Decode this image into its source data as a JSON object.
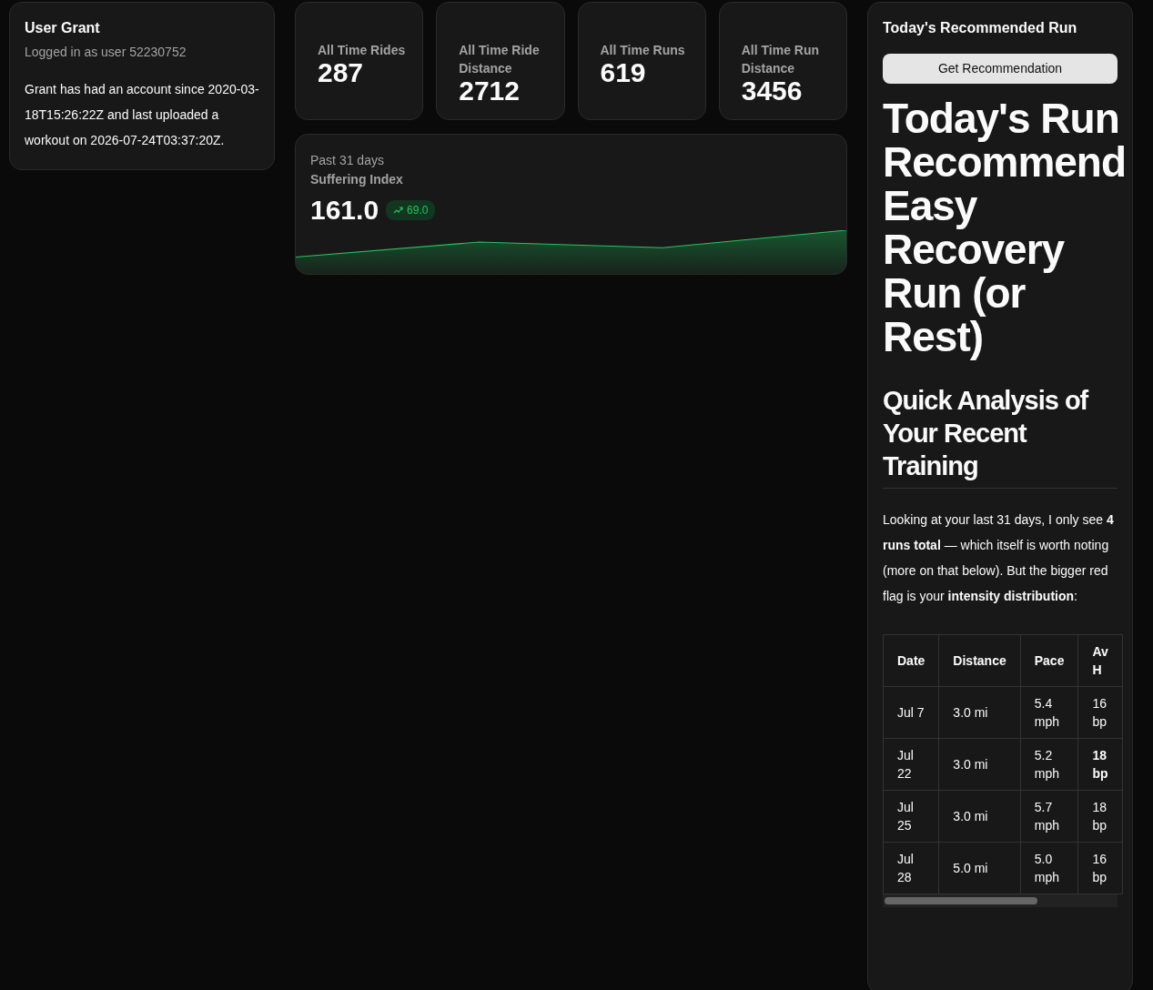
{
  "user_card": {
    "title": "User Grant",
    "subtitle": "Logged in as user 52230752",
    "description": "Grant has had an account since 2020-03-18T15:26:22Z and last uploaded a workout on 2026-07-24T03:37:20Z."
  },
  "stats": [
    {
      "label": "All Time Rides",
      "value": "287"
    },
    {
      "label": "All Time Ride Distance",
      "value": "2712"
    },
    {
      "label": "All Time Runs",
      "value": "619"
    },
    {
      "label": "All Time Run Distance",
      "value": "3456"
    }
  ],
  "suffering_card": {
    "period": "Past 31 days",
    "title": "Suffering Index",
    "value": "161.0",
    "trend": "69.0"
  },
  "recommendation": {
    "title": "Today's Recommended Run",
    "button": "Get Recommendation",
    "heading": "Today's Run Recommend Easy Recovery Run (or Rest)",
    "subheading": "Quick Analysis of Your Recent Training",
    "paragraph": "Looking at your last 31 days, I only see **4 runs total** — which itself is worth noting (more on that below). But the bigger red flag is your **intensity distribution**:",
    "table": {
      "columns": [
        "Date",
        "Distance",
        "Pace",
        "Av H"
      ],
      "rows": [
        {
          "cells": [
            "Jul 7",
            "3.0 mi",
            "5.4 mph",
            "16 bp"
          ],
          "highlighted": false
        },
        {
          "cells": [
            "Jul 22",
            "3.0 mi",
            "5.2 mph",
            "18 bp"
          ],
          "highlighted": true
        },
        {
          "cells": [
            "Jul 25",
            "3.0 mi",
            "5.7 mph",
            "18 bp"
          ],
          "highlighted": false
        },
        {
          "cells": [
            "Jul 28",
            "5.0 mi",
            "5.0 mph",
            "16 bp"
          ],
          "highlighted": false
        }
      ]
    }
  }
}
